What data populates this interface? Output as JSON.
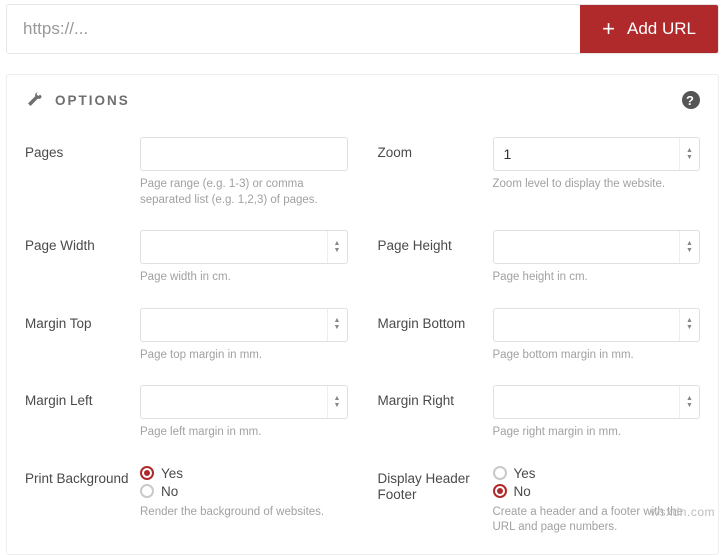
{
  "url_bar": {
    "placeholder": "https://...",
    "add_label": "Add URL"
  },
  "options": {
    "title": "OPTIONS",
    "pages": {
      "label": "Pages",
      "value": "",
      "help": "Page range (e.g. 1-3) or comma separated list (e.g. 1,2,3) of pages."
    },
    "zoom": {
      "label": "Zoom",
      "value": "1",
      "help": "Zoom level to display the website."
    },
    "page_width": {
      "label": "Page Width",
      "value": "",
      "help": "Page width in cm."
    },
    "page_height": {
      "label": "Page Height",
      "value": "",
      "help": "Page height in cm."
    },
    "margin_top": {
      "label": "Margin Top",
      "value": "",
      "help": "Page top margin in mm."
    },
    "margin_bottom": {
      "label": "Margin Bottom",
      "value": "",
      "help": "Page bottom margin in mm."
    },
    "margin_left": {
      "label": "Margin Left",
      "value": "",
      "help": "Page left margin in mm."
    },
    "margin_right": {
      "label": "Margin Right",
      "value": "",
      "help": "Page right margin in mm."
    },
    "print_background": {
      "label": "Print Background",
      "yes": "Yes",
      "no": "No",
      "selected": "yes",
      "help": "Render the background of websites."
    },
    "display_header_footer": {
      "label": "Display Header Footer",
      "yes": "Yes",
      "no": "No",
      "selected": "no",
      "help": "Create a header and a footer with the URL and page numbers."
    }
  },
  "watermark": "wsxdn.com"
}
